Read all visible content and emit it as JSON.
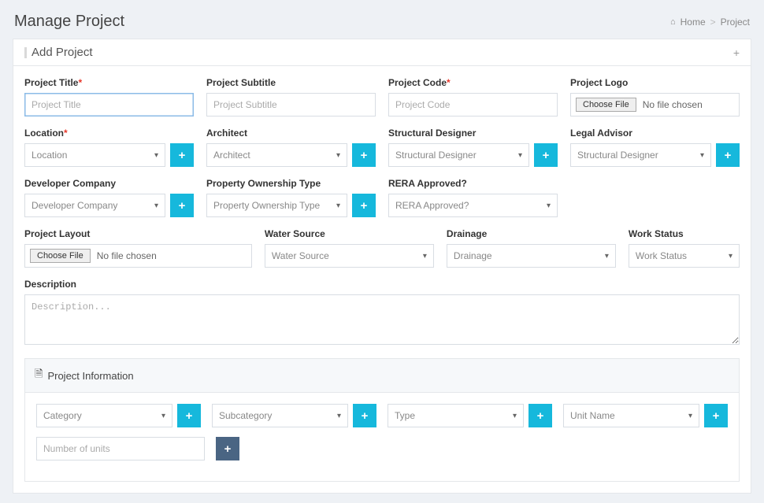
{
  "page_title": "Manage Project",
  "breadcrumb": {
    "home": "Home",
    "current": "Project"
  },
  "panel": {
    "title": "Add Project"
  },
  "fields": {
    "project_title": {
      "label": "Project Title",
      "placeholder": "Project Title",
      "required": true
    },
    "project_subtitle": {
      "label": "Project Subtitle",
      "placeholder": "Project Subtitle",
      "required": false
    },
    "project_code": {
      "label": "Project Code",
      "placeholder": "Project Code",
      "required": true
    },
    "project_logo": {
      "label": "Project Logo",
      "button": "Choose File",
      "status": "No file chosen"
    },
    "location": {
      "label": "Location",
      "placeholder": "Location",
      "required": true
    },
    "architect": {
      "label": "Architect",
      "placeholder": "Architect"
    },
    "structural": {
      "label": "Structural Designer",
      "placeholder": "Structural Designer"
    },
    "legal": {
      "label": "Legal Advisor",
      "placeholder": "Structural Designer"
    },
    "developer": {
      "label": "Developer Company",
      "placeholder": "Developer Company"
    },
    "ownership": {
      "label": "Property Ownership Type",
      "placeholder": "Property Ownership Type"
    },
    "rera": {
      "label": "RERA Approved?",
      "placeholder": "RERA Approved?"
    },
    "project_layout": {
      "label": "Project Layout",
      "button": "Choose File",
      "status": "No file chosen"
    },
    "water": {
      "label": "Water Source",
      "placeholder": "Water Source"
    },
    "drainage": {
      "label": "Drainage",
      "placeholder": "Drainage"
    },
    "work_status": {
      "label": "Work Status",
      "placeholder": "Work Status"
    },
    "description": {
      "label": "Description",
      "placeholder": "Description..."
    }
  },
  "project_info": {
    "title": "Project Information",
    "category": {
      "placeholder": "Category"
    },
    "subcategory": {
      "placeholder": "Subcategory"
    },
    "type": {
      "placeholder": "Type"
    },
    "unit_name": {
      "placeholder": "Unit Name"
    },
    "num_units": {
      "placeholder": "Number of units"
    }
  },
  "icons": {
    "plus": "+",
    "caret": "▾",
    "home": "⌂",
    "doc": "🗎",
    "sep": ">"
  }
}
